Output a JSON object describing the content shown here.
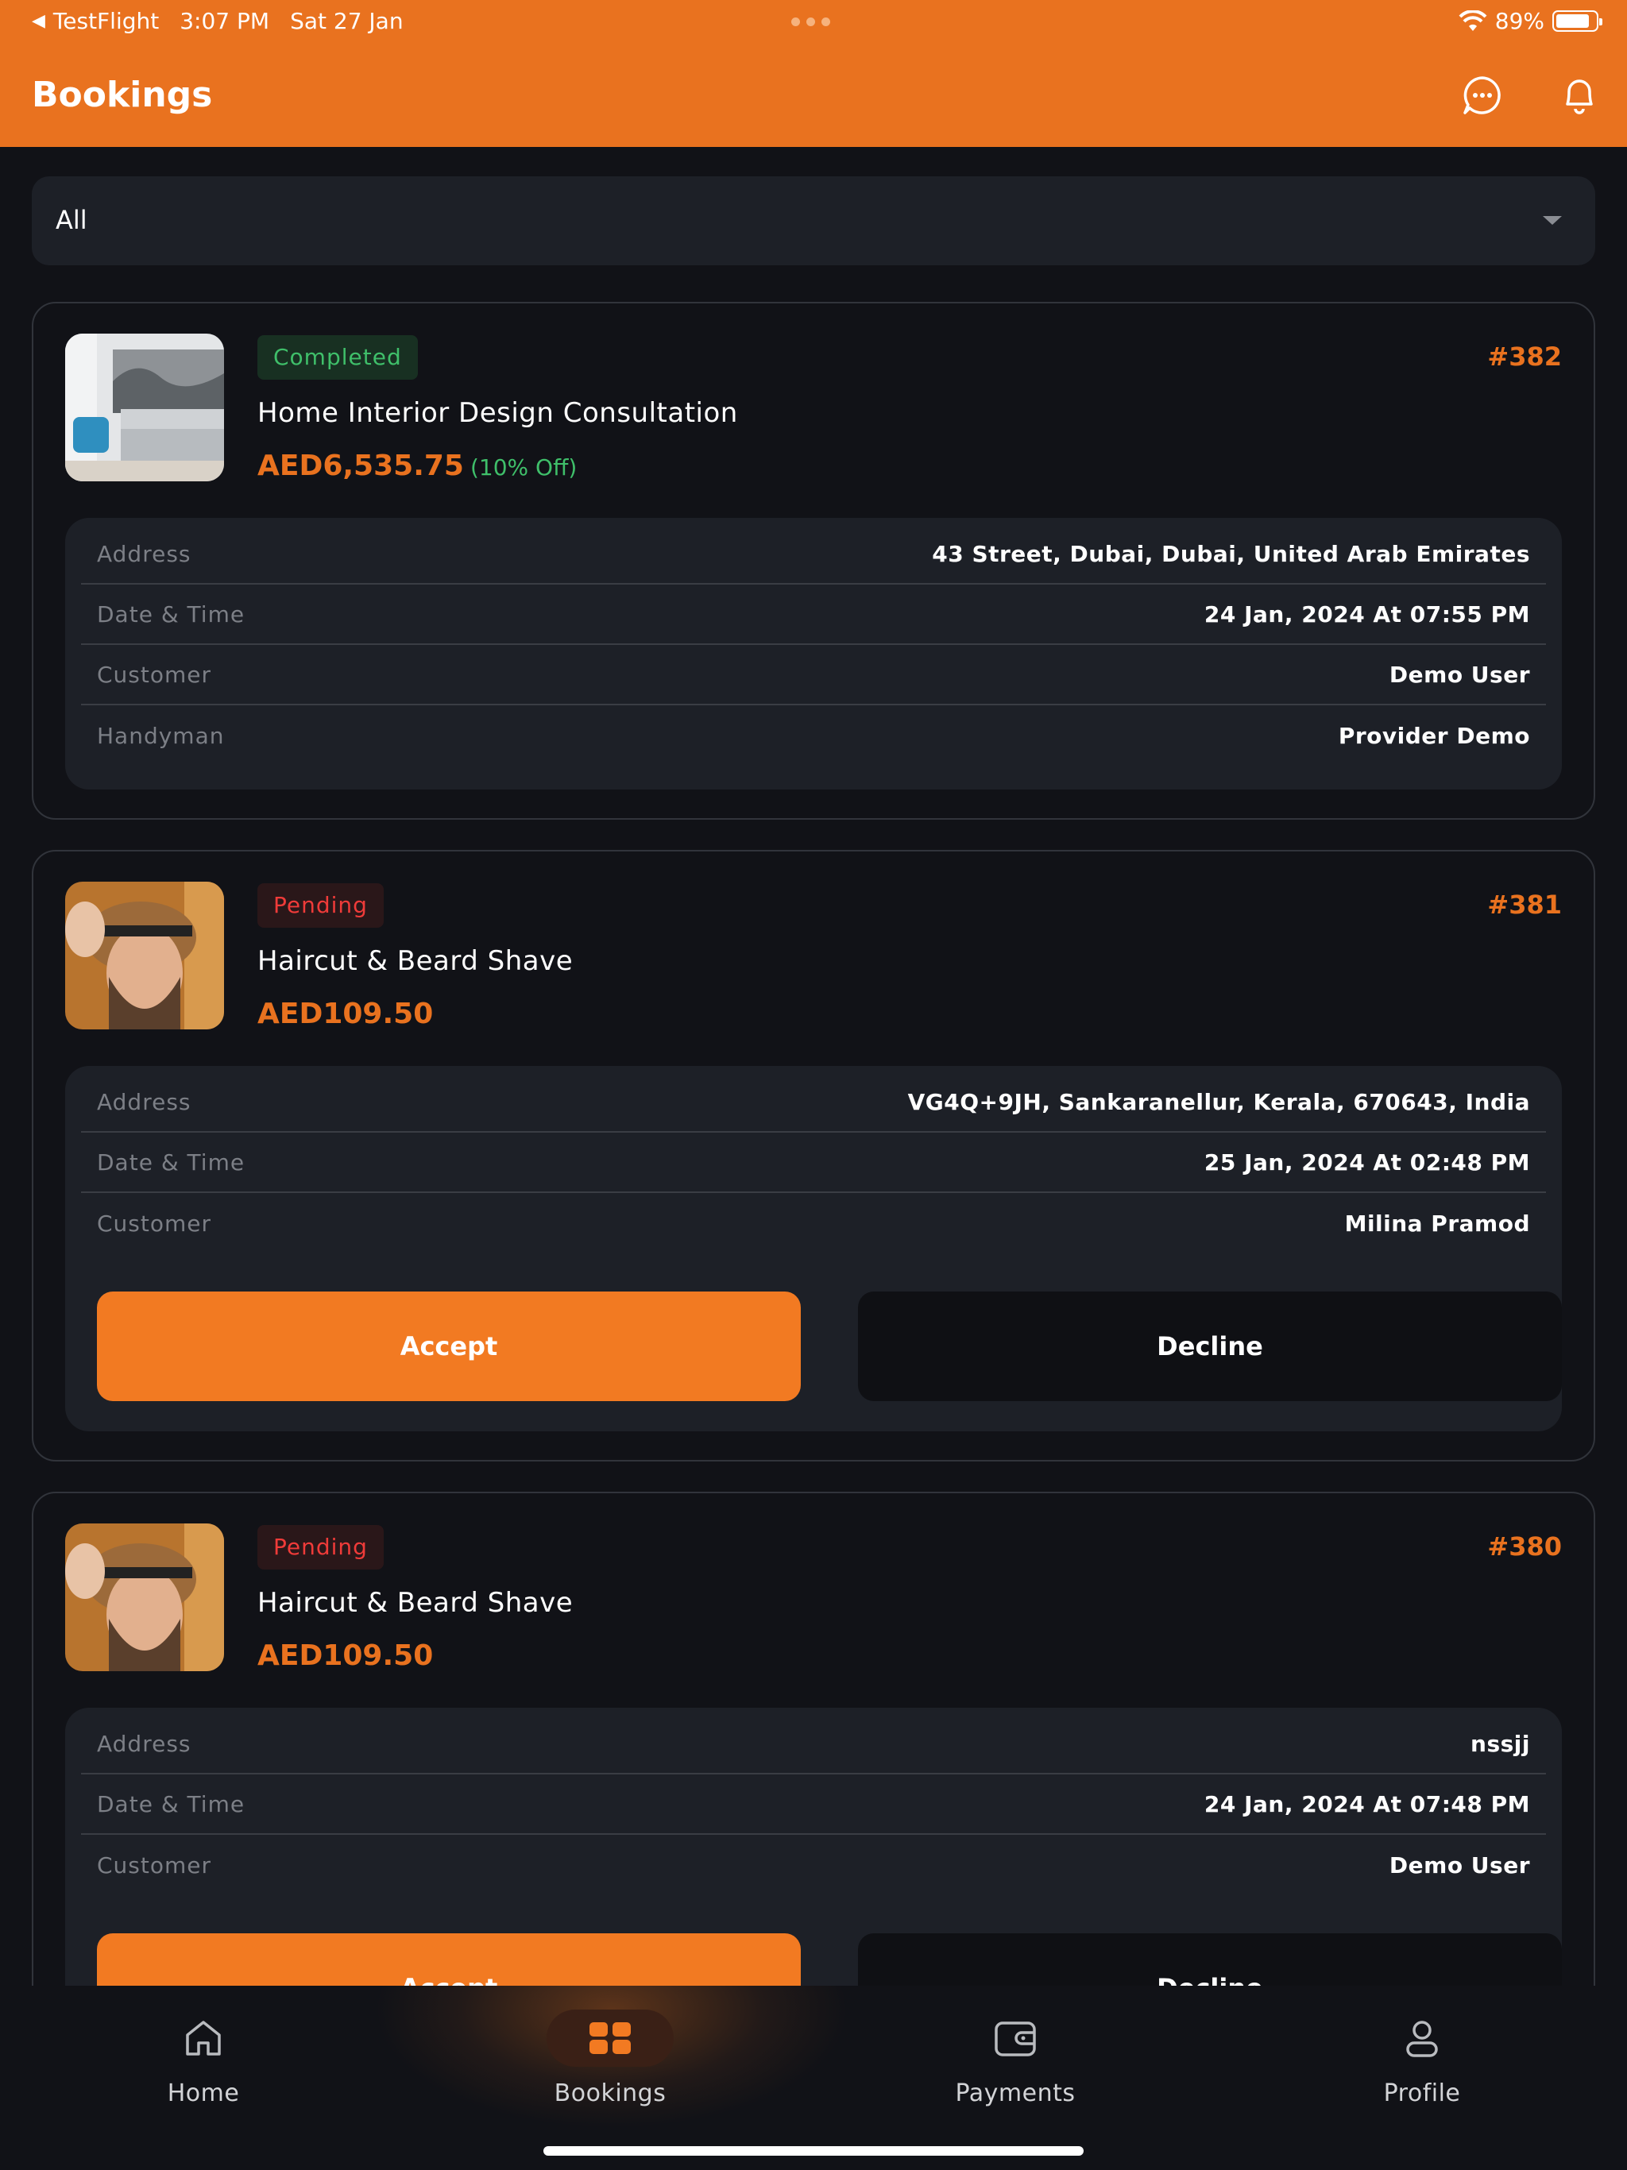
{
  "status_bar": {
    "back_app": "TestFlight",
    "time": "3:07 PM",
    "date": "Sat 27 Jan",
    "battery": "89%"
  },
  "header": {
    "title": "Bookings",
    "chat_icon": "chat-bubble-icon",
    "notification_icon": "bell-icon"
  },
  "filter": {
    "selected": "All"
  },
  "labels": {
    "address": "Address",
    "date_time": "Date & Time",
    "customer": "Customer",
    "handyman": "Handyman",
    "accept": "Accept",
    "decline": "Decline"
  },
  "bookings": [
    {
      "status": "Completed",
      "id": "#382",
      "title": "Home Interior Design Consultation",
      "price": "AED6,535.75",
      "discount": "(10% Off)",
      "address": "43 Street, Dubai, Dubai, United Arab Emirates",
      "date_time": "24 Jan, 2024 At 07:55 PM",
      "customer": "Demo User",
      "handyman": "Provider Demo"
    },
    {
      "status": "Pending",
      "id": "#381",
      "title": "Haircut & Beard Shave",
      "price": "AED109.50",
      "address": "VG4Q+9JH, Sankaranellur, Kerala, 670643, India",
      "date_time": "25 Jan, 2024 At 02:48 PM",
      "customer": "Milina Pramod"
    },
    {
      "status": "Pending",
      "id": "#380",
      "title": "Haircut & Beard Shave",
      "price": "AED109.50",
      "address": "nssjj",
      "date_time": "24 Jan, 2024 At 07:48 PM",
      "customer": "Demo User"
    }
  ],
  "nav": {
    "items": [
      {
        "label": "Home",
        "icon": "home-icon"
      },
      {
        "label": "Bookings",
        "icon": "bookings-icon",
        "active": true
      },
      {
        "label": "Payments",
        "icon": "wallet-icon"
      },
      {
        "label": "Profile",
        "icon": "user-icon"
      }
    ]
  },
  "colors": {
    "accent": "#e9721f",
    "background": "#111217",
    "surface": "#1d2027",
    "completed": "#3fbf6a",
    "pending": "#ef3b39"
  }
}
